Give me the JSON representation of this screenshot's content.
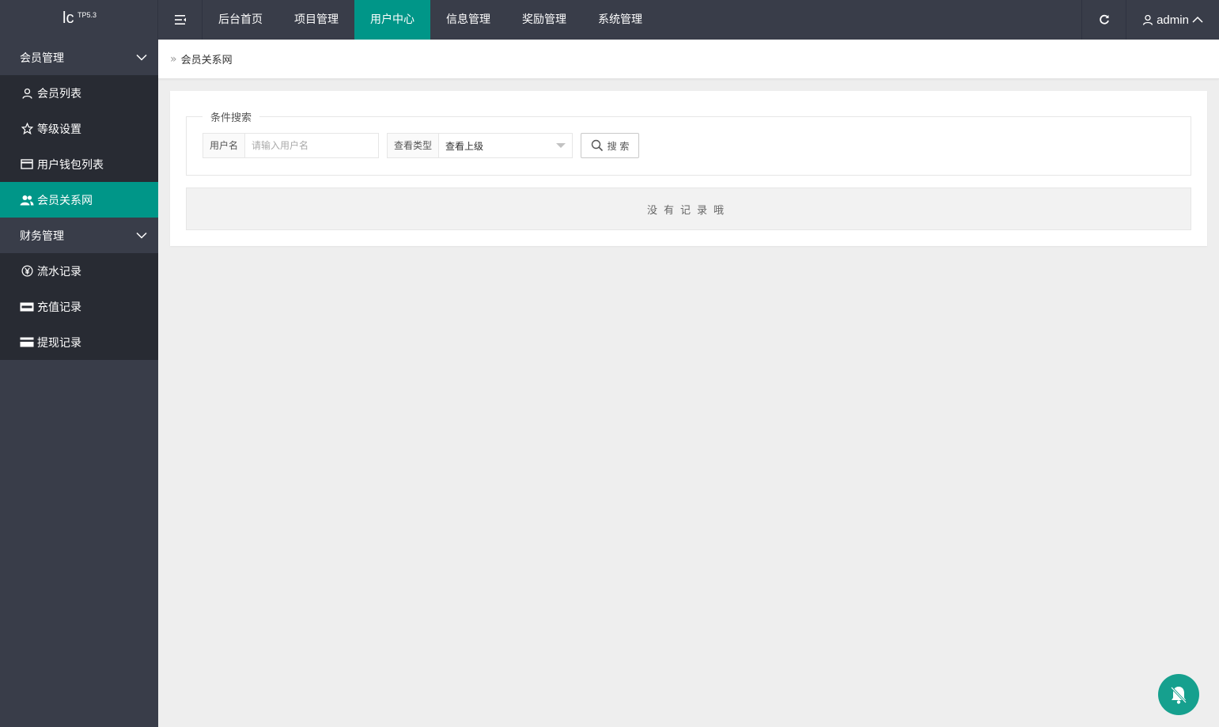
{
  "app": {
    "logo_text": "lc",
    "logo_sup": "TP5.3"
  },
  "topnav": {
    "items": [
      "后台首页",
      "项目管理",
      "用户中心",
      "信息管理",
      "奖励管理",
      "系统管理"
    ],
    "active": "用户中心",
    "user": "admin"
  },
  "sidebar": {
    "groups": [
      {
        "label": "会员管理",
        "items": [
          {
            "label": "会员列表",
            "icon": "user-icon"
          },
          {
            "label": "等级设置",
            "icon": "star-icon"
          },
          {
            "label": "用户钱包列表",
            "icon": "wallet-card-icon"
          },
          {
            "label": "会员关系网",
            "icon": "users-icon"
          }
        ]
      },
      {
        "label": "财务管理",
        "items": [
          {
            "label": "流水记录",
            "icon": "yen-icon"
          },
          {
            "label": "充值记录",
            "icon": "paypal-card-icon"
          },
          {
            "label": "提现记录",
            "icon": "credit-card-icon"
          }
        ]
      }
    ],
    "active": "会员关系网"
  },
  "breadcrumb": {
    "current": "会员关系网"
  },
  "search": {
    "legend": "条件搜索",
    "username_label": "用户名",
    "username_placeholder": "请输入用户名",
    "username_value": "",
    "type_label": "查看类型",
    "type_selected": "查看上级",
    "button_label": "搜 索"
  },
  "result": {
    "empty_text": "没有记录哦"
  },
  "colors": {
    "topbar": "#393d49",
    "sidebar_sub": "#282b33",
    "accent": "#009688",
    "float_button": "#16a08e"
  }
}
